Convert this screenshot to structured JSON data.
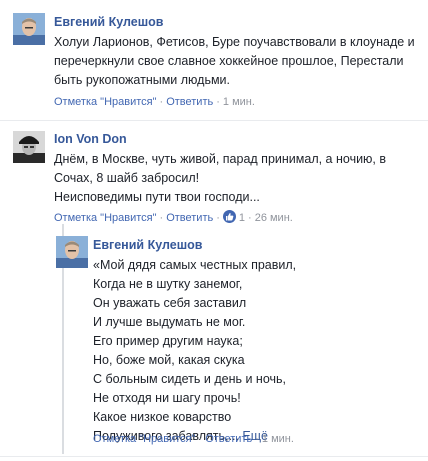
{
  "comments": [
    {
      "author": "Евгений Кулешов",
      "lines": [
        "Холуи Ларионов, Фетисов, Буре поучавствовали в клоунаде и",
        "перечеркнули свое славное хоккейное прошлое, Перестали",
        "быть рукопожатными людьми."
      ],
      "like_label": "Отметка \"Нравится\"",
      "reply_label": "Ответить",
      "time": "1 мин."
    },
    {
      "author": "Ion Von Don",
      "lines": [
        "Днём, в Москве, чуть живой, парад принимал, а ночию, в",
        "Сочах, 8 шайб забросил!",
        "Неисповедимы пути твои господи..."
      ],
      "like_label": "Отметка \"Нравится\"",
      "reply_label": "Ответить",
      "reaction_count": "1",
      "time": "26 мин."
    }
  ],
  "reply": {
    "author": "Евгений Кулешов",
    "lines": [
      "«Мой дядя самых честных правил,",
      "Когда не в шутку занемог,",
      "Он уважать себя заставил",
      "И лучше выдумать не мог.",
      "Его пример другим наука;",
      "Но, боже мой, какая скука",
      "С больным сидеть и день и ночь,",
      "Не отходя ни шагу прочь!",
      "Какое низкое коварство",
      "Полуживого забавлять,..."
    ],
    "more_label": "Ещё",
    "like_label": "Отметка \"Нравится\"",
    "reply_label": "Ответить",
    "time": "1 мин."
  },
  "icons": {
    "like_reaction": "thumbs-up-icon",
    "avatar_1": "avatar",
    "avatar_2": "avatar",
    "avatar_3": "avatar"
  },
  "colors": {
    "link": "#365899",
    "action_link": "#4267b2",
    "meta": "#90949c",
    "text": "#1d2129"
  }
}
